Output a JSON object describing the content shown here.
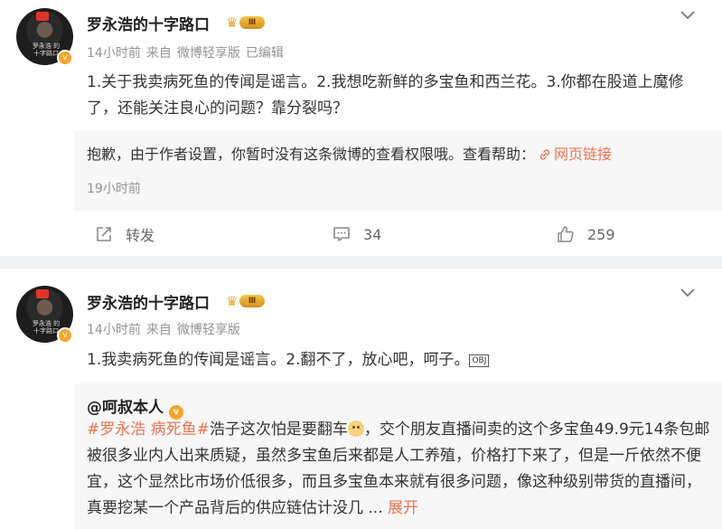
{
  "post1": {
    "author": "罗永浩的十字路口",
    "vip_level": "Ⅲ",
    "avatar_caption": "罗永浩 的十字路口",
    "meta": [
      "14小时前",
      "来自",
      "微博轻享版",
      "已编辑"
    ],
    "text": "1.关于我卖病死鱼的传闻是谣言。2.我想吃新鲜的多宝鱼和西兰花。3.你都在股道上魔修了，还能关注良心的问题？靠分裂吗？",
    "repost_message": "抱歉，由于作者设置，你暂时没有这条微博的查看权限哦。查看帮助：",
    "repost_link": "网页链接",
    "repost_time": "19小时前",
    "actions": {
      "repost": "转发",
      "comments": "34",
      "likes": "259"
    }
  },
  "post2": {
    "author": "罗永浩的十字路口",
    "vip_level": "Ⅲ",
    "avatar_caption": "罗永浩 的十字路口",
    "meta": [
      "14小时前",
      "来自",
      "微博轻享版"
    ],
    "text": "1.我卖病死鱼的传闻是谣言。2.翻不了，放心吧，呵子。",
    "obj_glyph": "OBJ",
    "quoted": {
      "author": "@呵叔本人",
      "tags": "#罗永浩 病死鱼#",
      "text_a": "浩子这次怕是要翻车",
      "text_b": "，交个朋友直播间卖的这个多宝鱼49.9元14条包邮被很多业内人出来质疑，虽然多宝鱼后来都是人工养殖，价格打下来了，但是一斤依然不便宜，这个显然比市场价低很多，而且多宝鱼本来就有很多问题，像这种级别带货的直播间，真要挖某一个产品背后的供应链估计没几 ...",
      "more": "展开"
    }
  },
  "colors": {
    "link": "#eb7350",
    "verified": "#f7a32b"
  }
}
